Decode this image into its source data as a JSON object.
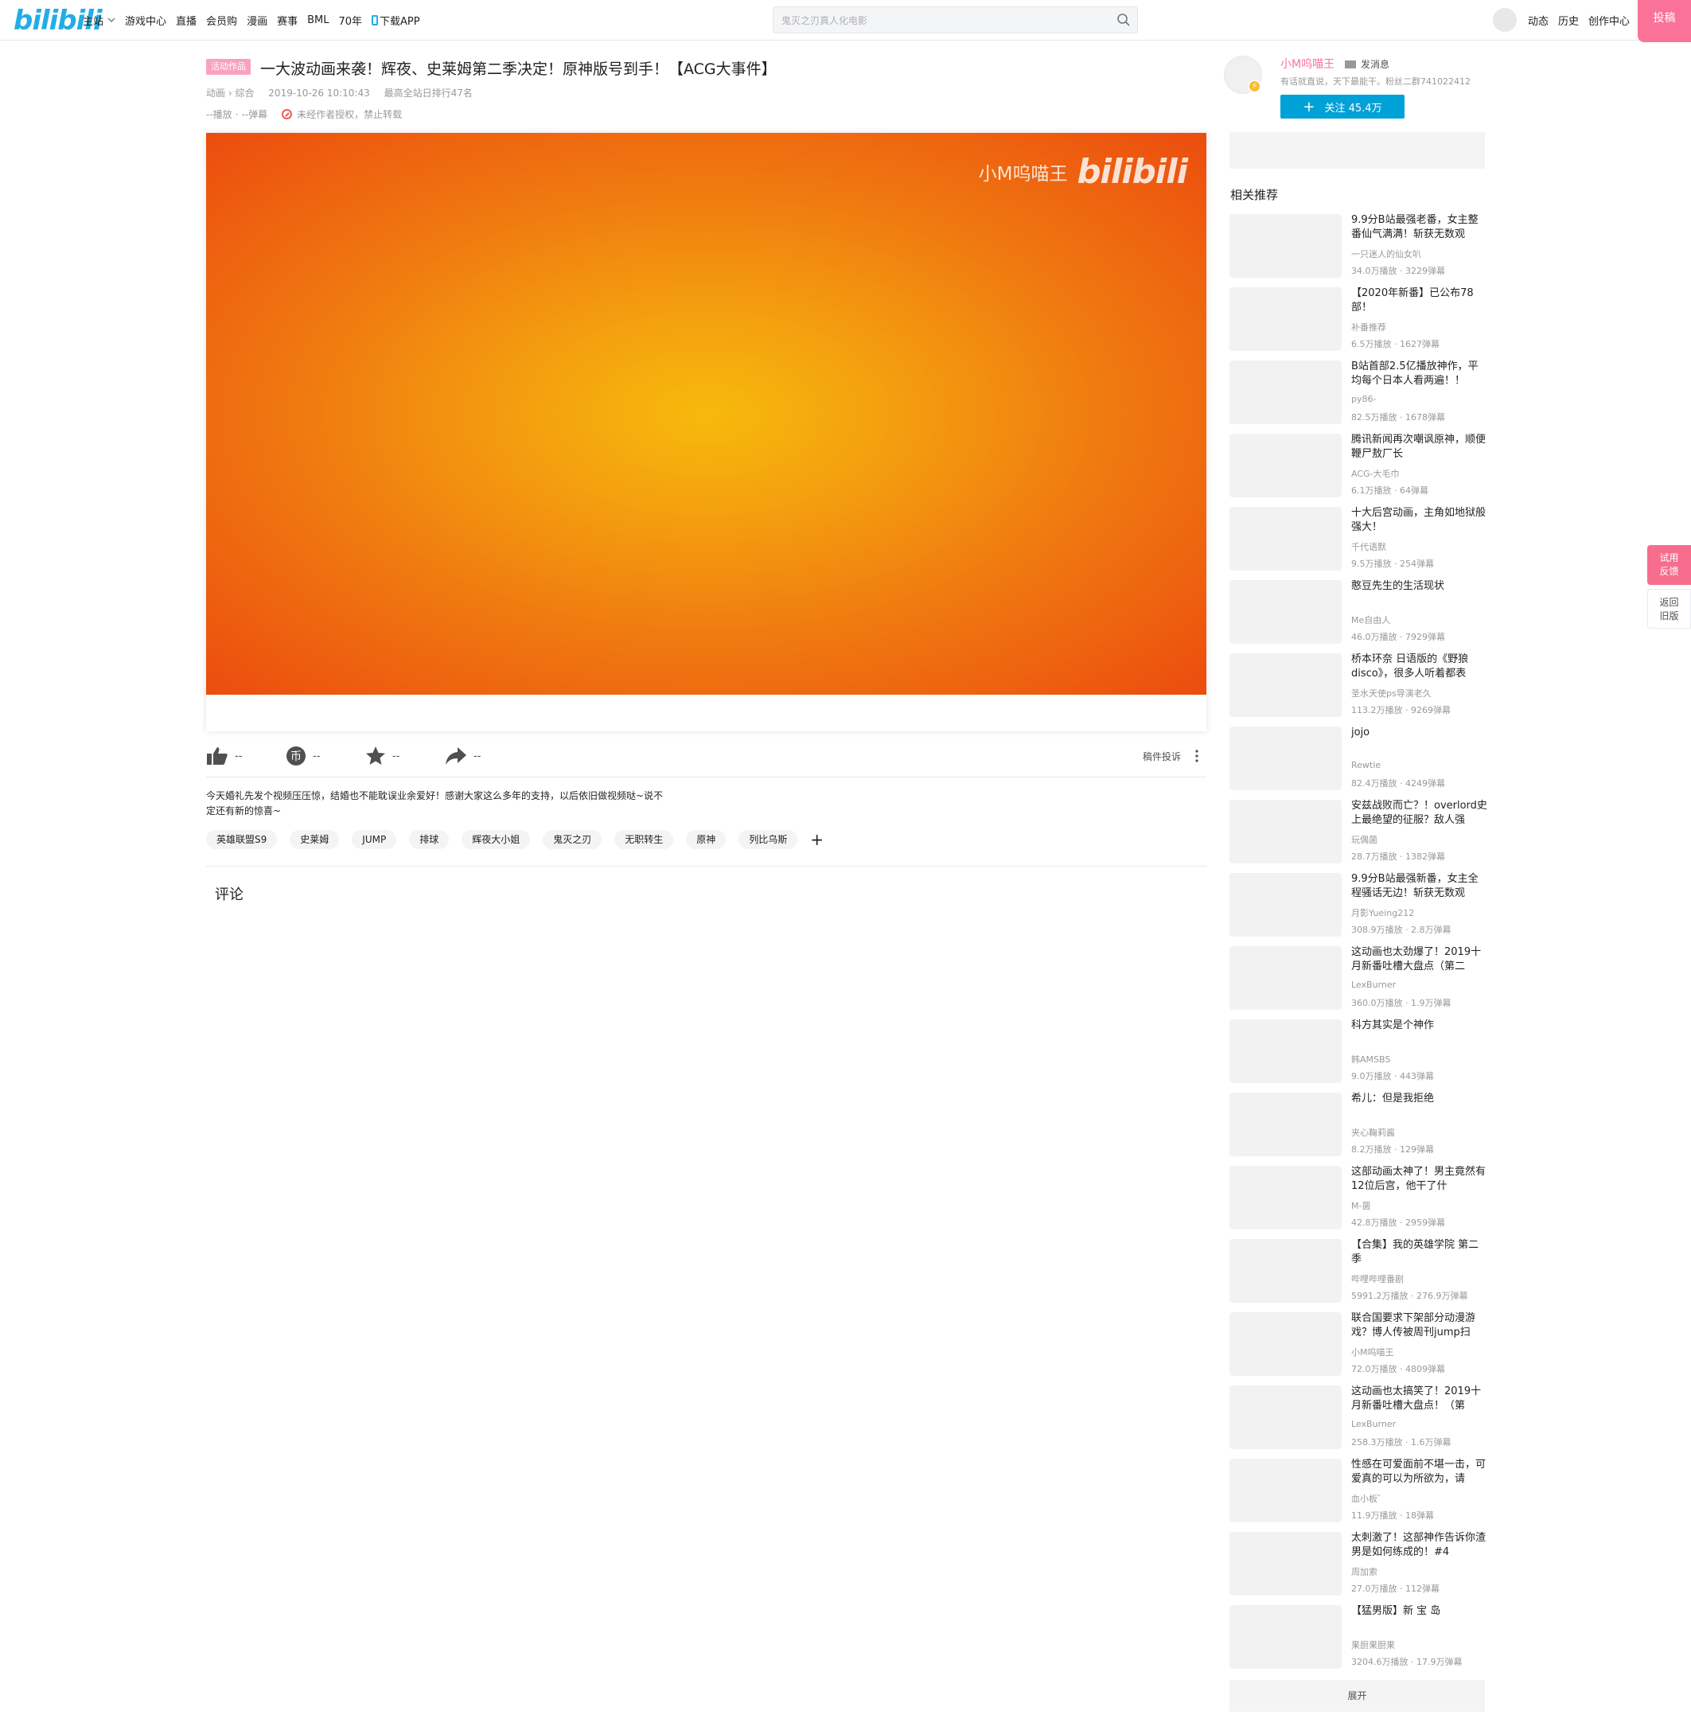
{
  "header": {
    "logo": "bilibili",
    "nav": [
      {
        "label": "主站",
        "has_dropdown": true
      },
      {
        "label": "游戏中心"
      },
      {
        "label": "直播"
      },
      {
        "label": "会员购"
      },
      {
        "label": "漫画"
      },
      {
        "label": "赛事"
      },
      {
        "label": "BML"
      },
      {
        "label": "70年"
      },
      {
        "label": "下载APP",
        "icon": "phone-icon"
      }
    ],
    "search_placeholder": "鬼灭之刃真人化电影",
    "right_nav": [
      "动态",
      "历史",
      "创作中心"
    ],
    "upload_label": "投稿",
    "accent_color": "#00a1d6",
    "pink_color": "#fb7299"
  },
  "video": {
    "tag": "活动作品",
    "title": "一大波动画来袭！辉夜、史莱姆第二季决定！原神版号到手！【ACG大事件】",
    "category": "动画",
    "subcategory": "综合",
    "date": "2019-10-26 10:10:43",
    "rank": "最高全站日排行47名",
    "plays": "--播放",
    "danmaku": "--弹幕",
    "copyright": "未经作者授权，禁止转载",
    "watermark_name": "小M呜喵王",
    "watermark_logo": "bilibili"
  },
  "actions": {
    "like": "--",
    "coin": "--",
    "favorite": "--",
    "share": "--",
    "report": "稿件投诉"
  },
  "description": "今天婚礼先发个视频压压惊，结婚也不能耽误业余爱好！感谢大家这么多年的支持，以后依旧做视频哒~说不定还有新的惊喜~",
  "tags": [
    "英雄联盟S9",
    "史莱姆",
    "JUMP",
    "排球",
    "辉夜大小姐",
    "鬼灭之刃",
    "无职转生",
    "原神",
    "列比乌斯"
  ],
  "comments_title": "评论",
  "up": {
    "name": "小M呜喵王",
    "send_message": "发消息",
    "desc": "有话就直说，天下最能干。粉丝二群741022412",
    "follow_label": "关注 45.4万"
  },
  "related_title": "相关推荐",
  "related": [
    {
      "title": "9.9分B站最强老番，女主整番仙气满满！斩获无数观",
      "up": "一只迷人的仙女叭",
      "plays": "34.0万播放",
      "danmaku": "3229弹幕"
    },
    {
      "title": "【2020年新番】已公布78部！",
      "up": "补番推荐",
      "plays": "6.5万播放",
      "danmaku": "1627弹幕"
    },
    {
      "title": "B站首部2.5亿播放神作，平均每个日本人看两遍！！",
      "up": "py86-",
      "plays": "82.5万播放",
      "danmaku": "1678弹幕"
    },
    {
      "title": "腾讯新闻再次嘲讽原神，顺便鞭尸敖厂长",
      "up": "ACG-大毛巾",
      "plays": "6.1万播放",
      "danmaku": "64弹幕"
    },
    {
      "title": "十大后宫动画，主角如地狱般强大！",
      "up": "千代语默",
      "plays": "9.5万播放",
      "danmaku": "254弹幕"
    },
    {
      "title": "憨豆先生的生活现状",
      "up": "Me自由人",
      "plays": "46.0万播放",
      "danmaku": "7929弹幕"
    },
    {
      "title": "桥本环奈 日语版的《野狼disco》，很多人听着都表",
      "up": "圣水天使ps导演老久",
      "plays": "113.2万播放",
      "danmaku": "9269弹幕"
    },
    {
      "title": "jojo",
      "up": "Rewtie",
      "plays": "82.4万播放",
      "danmaku": "4249弹幕"
    },
    {
      "title": "安兹战败而亡？！overlord史上最绝望的征服？敌人强",
      "up": "玩偶菌",
      "plays": "28.7万播放",
      "danmaku": "1382弹幕"
    },
    {
      "title": "9.9分B站最强新番，女主全程骚话无边！斩获无数观",
      "up": "月影Yueing212",
      "plays": "308.9万播放",
      "danmaku": "2.8万弹幕"
    },
    {
      "title": "这动画也太劲爆了！2019十月新番吐槽大盘点（第二",
      "up": "LexBurner",
      "plays": "360.0万播放",
      "danmaku": "1.9万弹幕"
    },
    {
      "title": "科方其实是个神作",
      "up": "韩AMSBS",
      "plays": "9.0万播放",
      "danmaku": "443弹幕"
    },
    {
      "title": "希儿：但是我拒绝",
      "up": "夹心鞠莉酱",
      "plays": "8.2万播放",
      "danmaku": "129弹幕"
    },
    {
      "title": "这部动画太神了！男主竟然有12位后宫，他干了什",
      "up": "M-菌",
      "plays": "42.8万播放",
      "danmaku": "2959弹幕"
    },
    {
      "title": "【合集】我的英雄学院 第二季",
      "up": "哔哩哔哩番剧",
      "plays": "5991.2万播放",
      "danmaku": "276.9万弹幕"
    },
    {
      "title": "联合国要求下架部分动漫游戏？博人传被周刊jump扫",
      "up": "小M呜喵王",
      "plays": "72.0万播放",
      "danmaku": "4809弹幕"
    },
    {
      "title": "这动画也太搞笑了！2019十月新番吐槽大盘点！（第",
      "up": "LexBurner",
      "plays": "258.3万播放",
      "danmaku": "1.6万弹幕"
    },
    {
      "title": "性感在可爱面前不堪一击，可爱真的可以为所欲为，请",
      "up": "血小板゛",
      "plays": "11.9万播放",
      "danmaku": "18弹幕"
    },
    {
      "title": "太刺激了！这部神作告诉你渣男是如何练成的！#4",
      "up": "周加索",
      "plays": "27.0万播放",
      "danmaku": "112弹幕"
    },
    {
      "title": "【猛男版】新 宝 岛",
      "up": "果厨果厨果",
      "plays": "3204.6万播放",
      "danmaku": "17.9万弹幕"
    }
  ],
  "expand_label": "展开",
  "floating": {
    "feedback_1": "试用",
    "feedback_2": "反馈",
    "old_1": "返回",
    "old_2": "旧版"
  }
}
